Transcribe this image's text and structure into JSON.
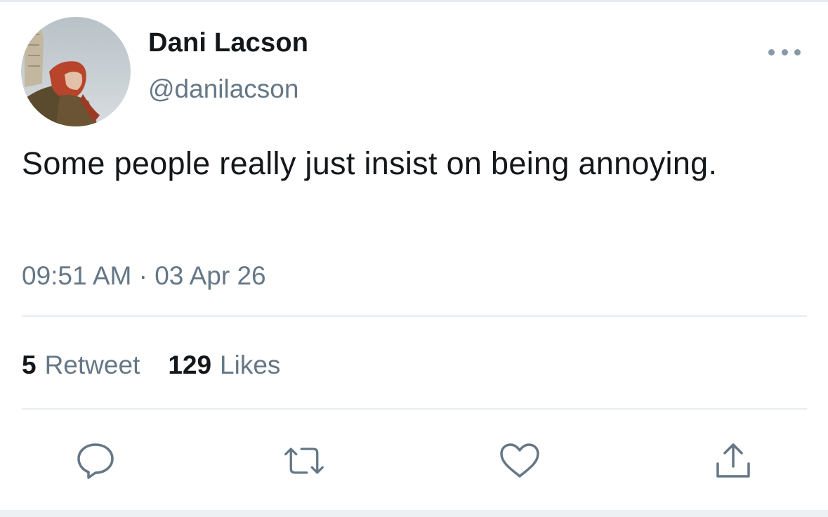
{
  "author": {
    "display_name": "Dani Lacson",
    "handle": "@danilacson",
    "avatar_alt": "profile photo"
  },
  "tweet": {
    "text": "Some people really just insist on being annoying.",
    "timestamp": "09:51 AM · 03 Apr 26"
  },
  "stats": {
    "retweets_count": "5",
    "retweets_label": "Retweet",
    "likes_count": "129",
    "likes_label": "Likes"
  },
  "icons": {
    "more": "more-horizontal-icon",
    "reply": "reply-icon",
    "retweet": "retweet-icon",
    "like": "heart-icon",
    "share": "share-icon"
  },
  "colors": {
    "text_primary": "#14171a",
    "text_secondary": "#657786",
    "icon_gray": "#8899a6",
    "divider": "#e6ecf0"
  }
}
